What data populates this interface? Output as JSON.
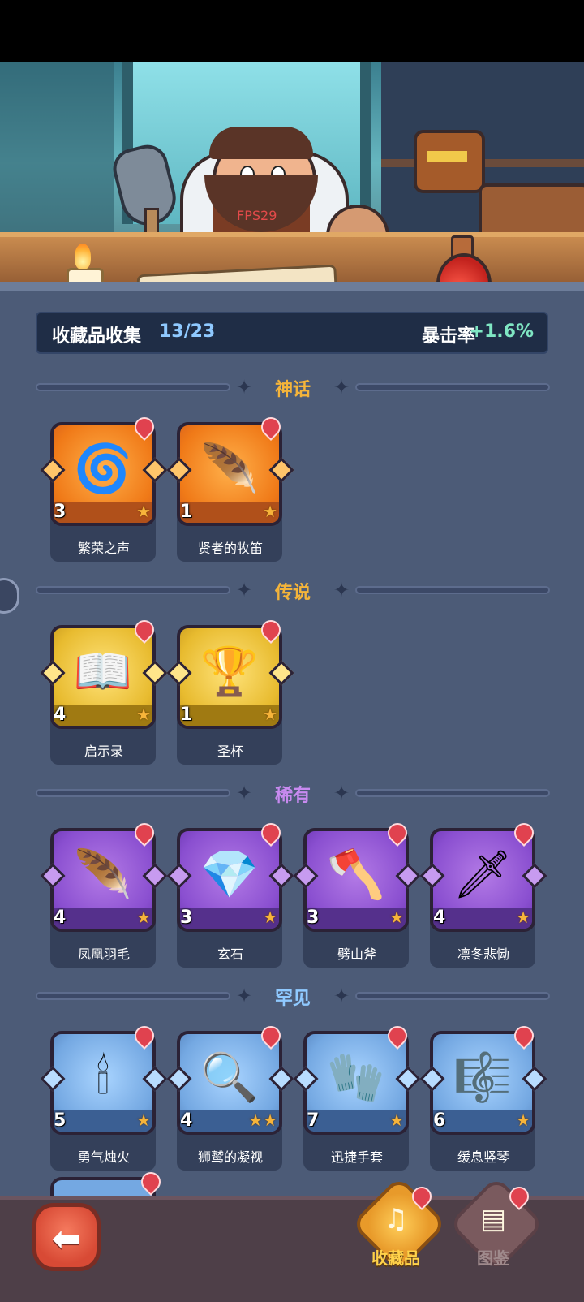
{
  "overlay": {
    "fps": "FPS29"
  },
  "collection": {
    "title": "收藏品收集",
    "count": "13/23",
    "crit_label": "暴击率",
    "crit_value": "+1.6%"
  },
  "sections": [
    {
      "title": "神话",
      "color": "#f4b43a",
      "items": [
        {
          "name": "繁荣之声",
          "level": "3",
          "stars": "★",
          "icon": "feather-orb-icon",
          "glyph": "🌀"
        },
        {
          "name": "贤者的牧笛",
          "level": "1",
          "stars": "★",
          "icon": "flute-icon",
          "glyph": "🪶"
        }
      ]
    },
    {
      "title": "传说",
      "color": "#f4b43a",
      "items": [
        {
          "name": "启示录",
          "level": "4",
          "stars": "★",
          "icon": "book-icon",
          "glyph": "📖"
        },
        {
          "name": "圣杯",
          "level": "1",
          "stars": "★",
          "icon": "chalice-icon",
          "glyph": "🏆"
        }
      ]
    },
    {
      "title": "稀有",
      "color": "#c88af0",
      "items": [
        {
          "name": "凤凰羽毛",
          "level": "4",
          "stars": "★",
          "icon": "phoenix-feather-icon",
          "glyph": "🪶"
        },
        {
          "name": "玄石",
          "level": "3",
          "stars": "★",
          "icon": "crystal-stone-icon",
          "glyph": "💎"
        },
        {
          "name": "劈山斧",
          "level": "3",
          "stars": "★",
          "icon": "axe-icon",
          "glyph": "🪓"
        },
        {
          "name": "凛冬悲恸",
          "level": "4",
          "stars": "★",
          "icon": "ice-sword-icon",
          "glyph": "🗡"
        }
      ]
    },
    {
      "title": "罕见",
      "color": "#8fc9ff",
      "items": [
        {
          "name": "勇气烛火",
          "level": "5",
          "stars": "★",
          "icon": "candle-icon",
          "glyph": "🕯"
        },
        {
          "name": "狮鹫的凝视",
          "level": "4",
          "stars": "★★",
          "icon": "monocle-icon",
          "glyph": "🔍"
        },
        {
          "name": "迅捷手套",
          "level": "7",
          "stars": "★",
          "icon": "glove-icon",
          "glyph": "🧤"
        },
        {
          "name": "缓息竖琴",
          "level": "6",
          "stars": "★",
          "icon": "harp-icon",
          "glyph": "🎼"
        }
      ]
    }
  ],
  "nav": {
    "collection_label": "收藏品",
    "codex_label": "图鉴"
  }
}
